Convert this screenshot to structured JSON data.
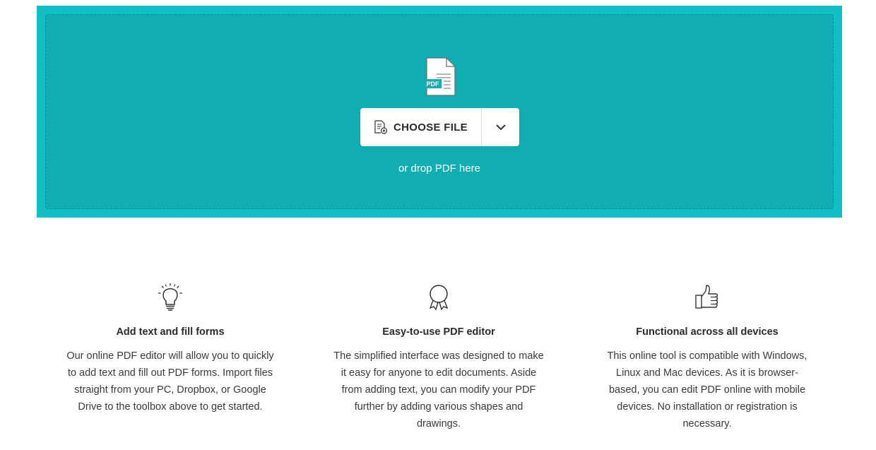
{
  "upload": {
    "file_badge": "PDF",
    "choose_file_label": "CHOOSE FILE",
    "drop_hint": "or drop PDF here",
    "colors": {
      "outer": "#11c0c4",
      "inner": "#10aeb2"
    }
  },
  "features": [
    {
      "icon": "lightbulb-icon",
      "title": "Add text and fill forms",
      "description": "Our online PDF editor will allow you to quickly to add text and fill out PDF forms. Import files straight from your PC, Dropbox, or Google Drive to the toolbox above to get started."
    },
    {
      "icon": "award-ribbon-icon",
      "title": "Easy-to-use PDF editor",
      "description": "The simplified interface was designed to make it easy for anyone to edit documents. Aside from adding text, you can modify your PDF further by adding various shapes and drawings."
    },
    {
      "icon": "thumbs-up-icon",
      "title": "Functional across all devices",
      "description": "This online tool is compatible with Windows, Linux and Mac devices. As it is browser-based, you can edit PDF online with mobile devices. No installation or registration is necessary."
    }
  ]
}
